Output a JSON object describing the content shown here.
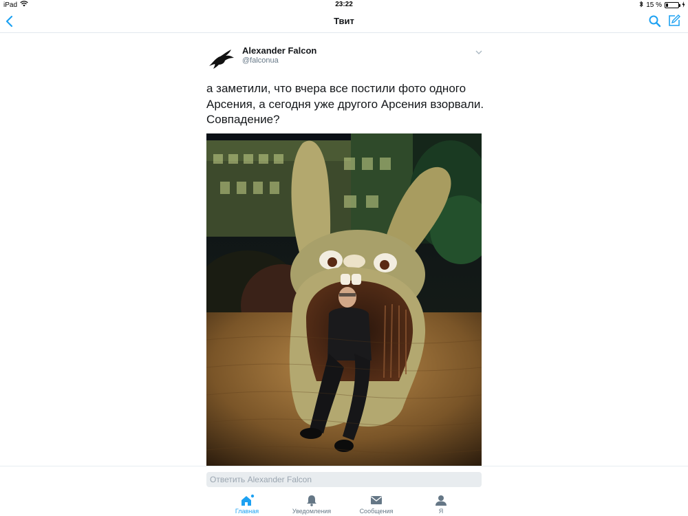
{
  "status_bar": {
    "device": "iPad",
    "time": "23:22",
    "battery": "15 %",
    "battery_level": 0.15
  },
  "nav": {
    "title": "Твит"
  },
  "tweet": {
    "author_name": "Alexander Falcon",
    "author_handle": "@falconua",
    "text_lines": [
      "а заметили, что вчера все постили фото одного",
      "Арсения, а сегодня уже другого Арсения взорвали.",
      "Совпадение?"
    ]
  },
  "reply": {
    "placeholder": "Ответить Alexander Falcon"
  },
  "tabs": [
    {
      "label": "Главная",
      "icon": "home-icon",
      "active": true
    },
    {
      "label": "Уведомления",
      "icon": "bell-icon",
      "active": false
    },
    {
      "label": "Сообщения",
      "icon": "envelope-icon",
      "active": false
    },
    {
      "label": "Я",
      "icon": "person-icon",
      "active": false
    }
  ],
  "colors": {
    "accent": "#1da1f2",
    "text": "#14171a",
    "muted": "#657786"
  }
}
